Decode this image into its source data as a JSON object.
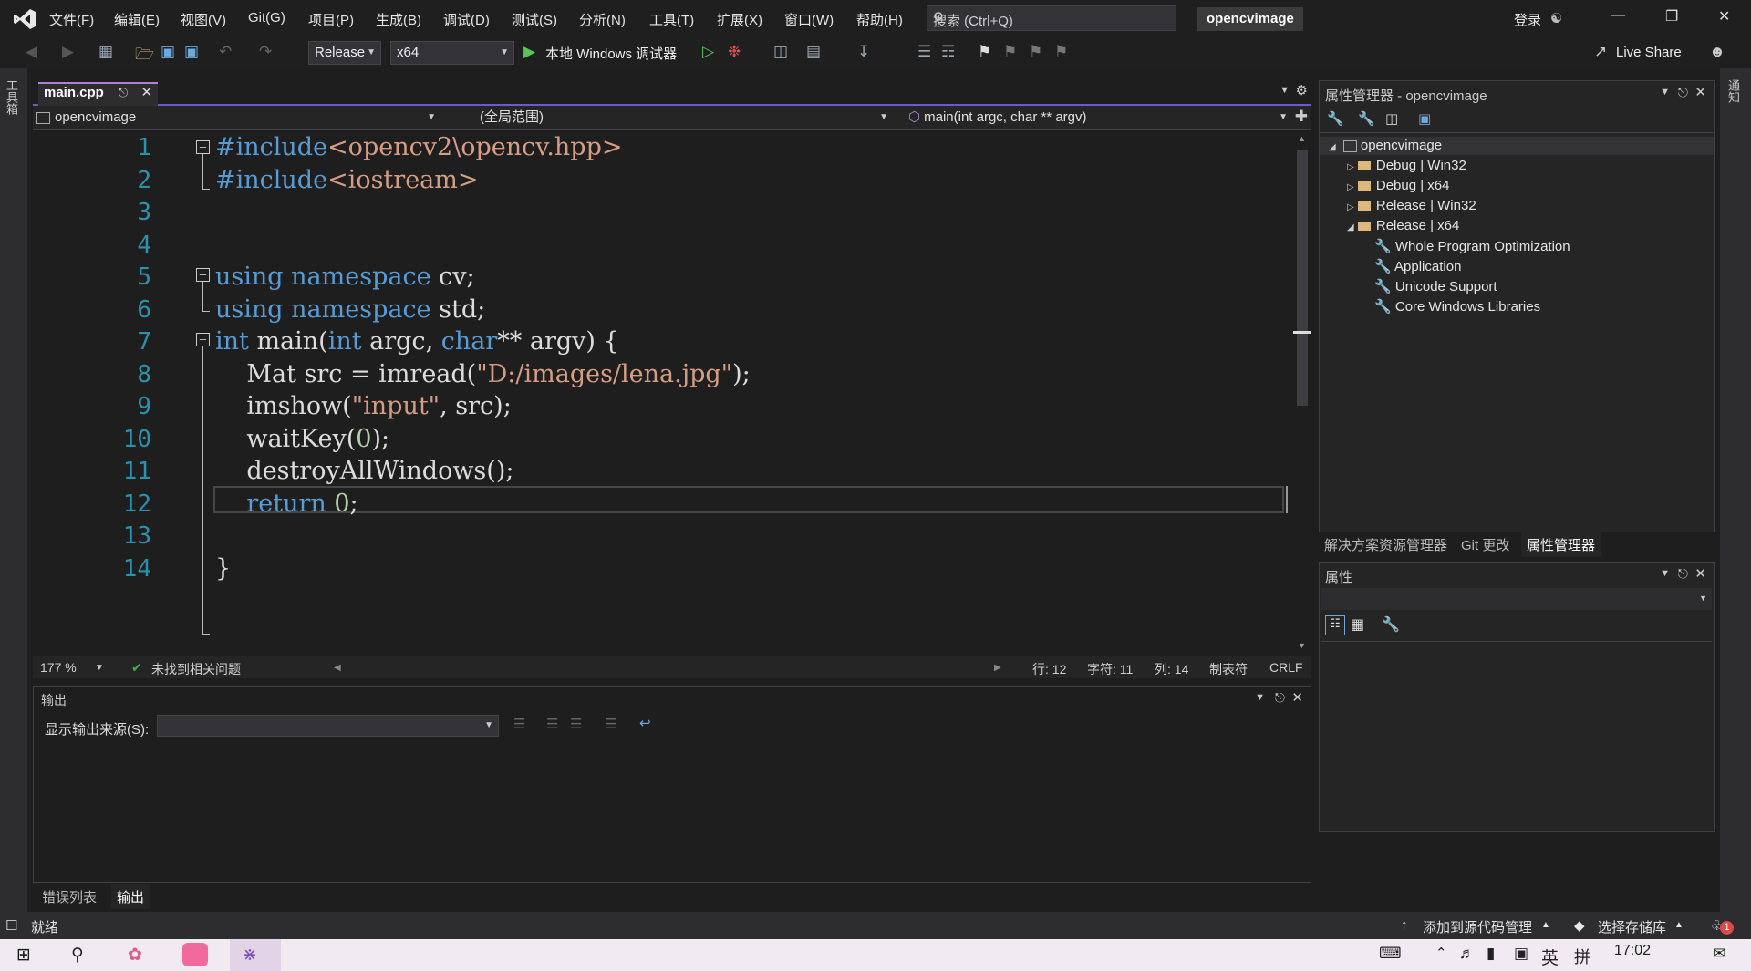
{
  "menu": {
    "items": [
      "文件(F)",
      "编辑(E)",
      "视图(V)",
      "Git(G)",
      "项目(P)",
      "生成(B)",
      "调试(D)",
      "测试(S)",
      "分析(N)",
      "工具(T)",
      "扩展(X)",
      "窗口(W)",
      "帮助(H)"
    ],
    "search_placeholder": "搜索 (Ctrl+Q)",
    "solution_name": "opencvimage",
    "login": "登录"
  },
  "toolbar": {
    "config": "Release",
    "platform": "x64",
    "run_label": "本地 Windows 调试器",
    "live_share": "Live Share"
  },
  "left_strip": {
    "label": "工具箱"
  },
  "editor": {
    "tab_name": "main.cpp",
    "nav_project": "opencvimage",
    "nav_scope": "(全局范围)",
    "nav_function": "main(int argc, char ** argv)",
    "line_numbers": [
      "1",
      "2",
      "3",
      "4",
      "5",
      "6",
      "7",
      "8",
      "9",
      "10",
      "11",
      "12",
      "13",
      "14"
    ],
    "lines": [
      {
        "segs": [
          {
            "t": "#include",
            "c": "kw"
          },
          {
            "t": "<opencv2\\opencv.hpp>",
            "c": "inc"
          }
        ]
      },
      {
        "segs": [
          {
            "t": "#include",
            "c": "kw"
          },
          {
            "t": "<iostream>",
            "c": "inc"
          }
        ]
      },
      {
        "segs": []
      },
      {
        "segs": []
      },
      {
        "segs": [
          {
            "t": "using",
            "c": "kw"
          },
          {
            "t": " "
          },
          {
            "t": "namespace",
            "c": "kw"
          },
          {
            "t": " cv;"
          }
        ]
      },
      {
        "segs": [
          {
            "t": "using",
            "c": "kw"
          },
          {
            "t": " "
          },
          {
            "t": "namespace",
            "c": "kw"
          },
          {
            "t": " std;"
          }
        ]
      },
      {
        "segs": [
          {
            "t": "int",
            "c": "kw"
          },
          {
            "t": " main("
          },
          {
            "t": "int",
            "c": "kw"
          },
          {
            "t": " argc, "
          },
          {
            "t": "char",
            "c": "kw"
          },
          {
            "t": "** argv) {"
          }
        ]
      },
      {
        "segs": [
          {
            "t": "    Mat src = imread("
          },
          {
            "t": "\"D:/images/lena.jpg\"",
            "c": "str"
          },
          {
            "t": ");"
          }
        ]
      },
      {
        "segs": [
          {
            "t": "    imshow("
          },
          {
            "t": "\"input\"",
            "c": "str"
          },
          {
            "t": ", src);"
          }
        ]
      },
      {
        "segs": [
          {
            "t": "    waitKey("
          },
          {
            "t": "0",
            "c": "num"
          },
          {
            "t": ");"
          }
        ]
      },
      {
        "segs": [
          {
            "t": "    destroyAllWindows();"
          }
        ]
      },
      {
        "segs": [
          {
            "t": "    "
          },
          {
            "t": "return",
            "c": "kw"
          },
          {
            "t": " "
          },
          {
            "t": "0",
            "c": "num"
          },
          {
            "t": ";"
          }
        ]
      },
      {
        "segs": []
      },
      {
        "segs": [
          {
            "t": "}"
          }
        ]
      }
    ]
  },
  "editor_status": {
    "zoom": "177 %",
    "issues": "未找到相关问题",
    "line": "行: 12",
    "char": "字符: 11",
    "col": "列: 14",
    "tabs": "制表符",
    "eol": "CRLF"
  },
  "output": {
    "title": "输出",
    "source_label": "显示输出来源(S):"
  },
  "bottom_tabs": [
    "错误列表",
    "输出"
  ],
  "property_manager": {
    "title": "属性管理器 - opencvimage",
    "root": "opencvimage",
    "configs": [
      "Debug | Win32",
      "Debug | x64",
      "Release | Win32",
      "Release | x64"
    ],
    "release_x64_children": [
      "Whole Program Optimization",
      "Application",
      "Unicode Support",
      "Core Windows Libraries"
    ]
  },
  "right_tabs": [
    "解决方案资源管理器",
    "Git 更改",
    "属性管理器"
  ],
  "properties": {
    "title": "属性"
  },
  "right_strip": {
    "label": "通知"
  },
  "statusbar": {
    "ready": "就绪",
    "add_source": "添加到源代码管理",
    "select_repo": "选择存储库",
    "notif_count": "1"
  },
  "taskbar": {
    "ime": "英",
    "ime2": "拼",
    "time": "17:02"
  },
  "colors": {
    "accent": "#b180d7",
    "background": "#1e1e1e",
    "keyword": "#569cd6",
    "string": "#d69d85",
    "line_number": "#2b91af"
  }
}
